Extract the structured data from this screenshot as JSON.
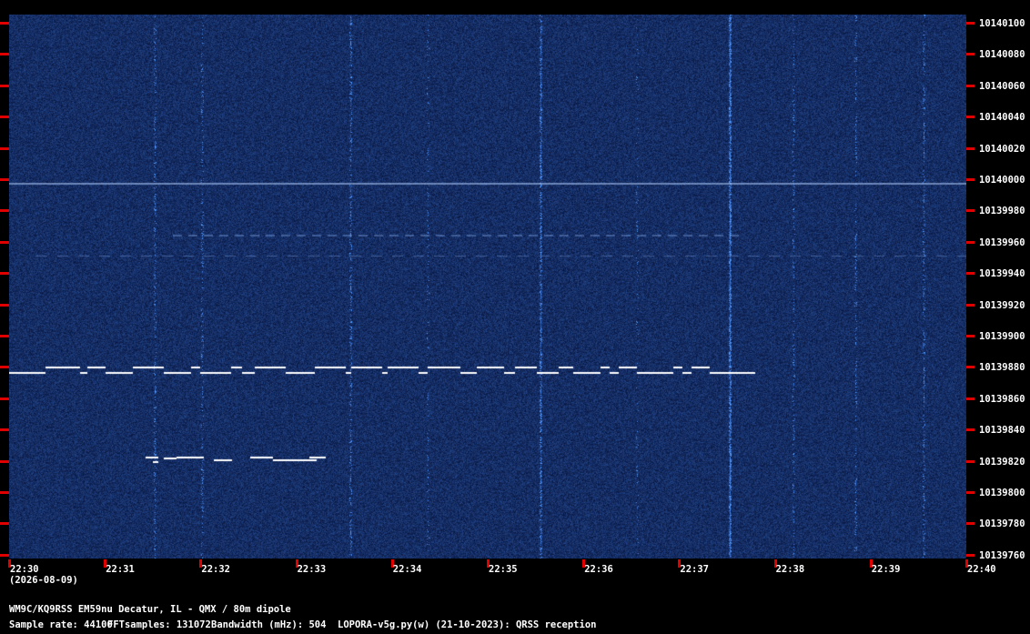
{
  "freq_labels": [
    "10140100",
    "10140080",
    "10140060",
    "10140040",
    "10140020",
    "10140000",
    "10139980",
    "10139960",
    "10139940",
    "10139920",
    "10139900",
    "10139880",
    "10139860",
    "10139840",
    "10139820",
    "10139800",
    "10139780",
    "10139760"
  ],
  "time_labels": [
    "22:30",
    "22:31",
    "22:32",
    "22:33",
    "22:34",
    "22:35",
    "22:36",
    "22:37",
    "22:38",
    "22:39",
    "22:40"
  ],
  "date_label": "(2026-08-09)",
  "station_line": "WM9C/KQ9RSS EM59nu Decatur, IL - QMX / 80m dipole",
  "sample_rate": "Sample rate: 44100",
  "fft_samples": "FFTsamples: 131072",
  "bandwidth": "Bandwidth (mHz): 504",
  "software": "LOPORA-v5g.py(w) (21-10-2023): QRSS reception",
  "colors": {
    "background": "#06123a",
    "signal": "#ffffff",
    "tick": "#e00000"
  }
}
